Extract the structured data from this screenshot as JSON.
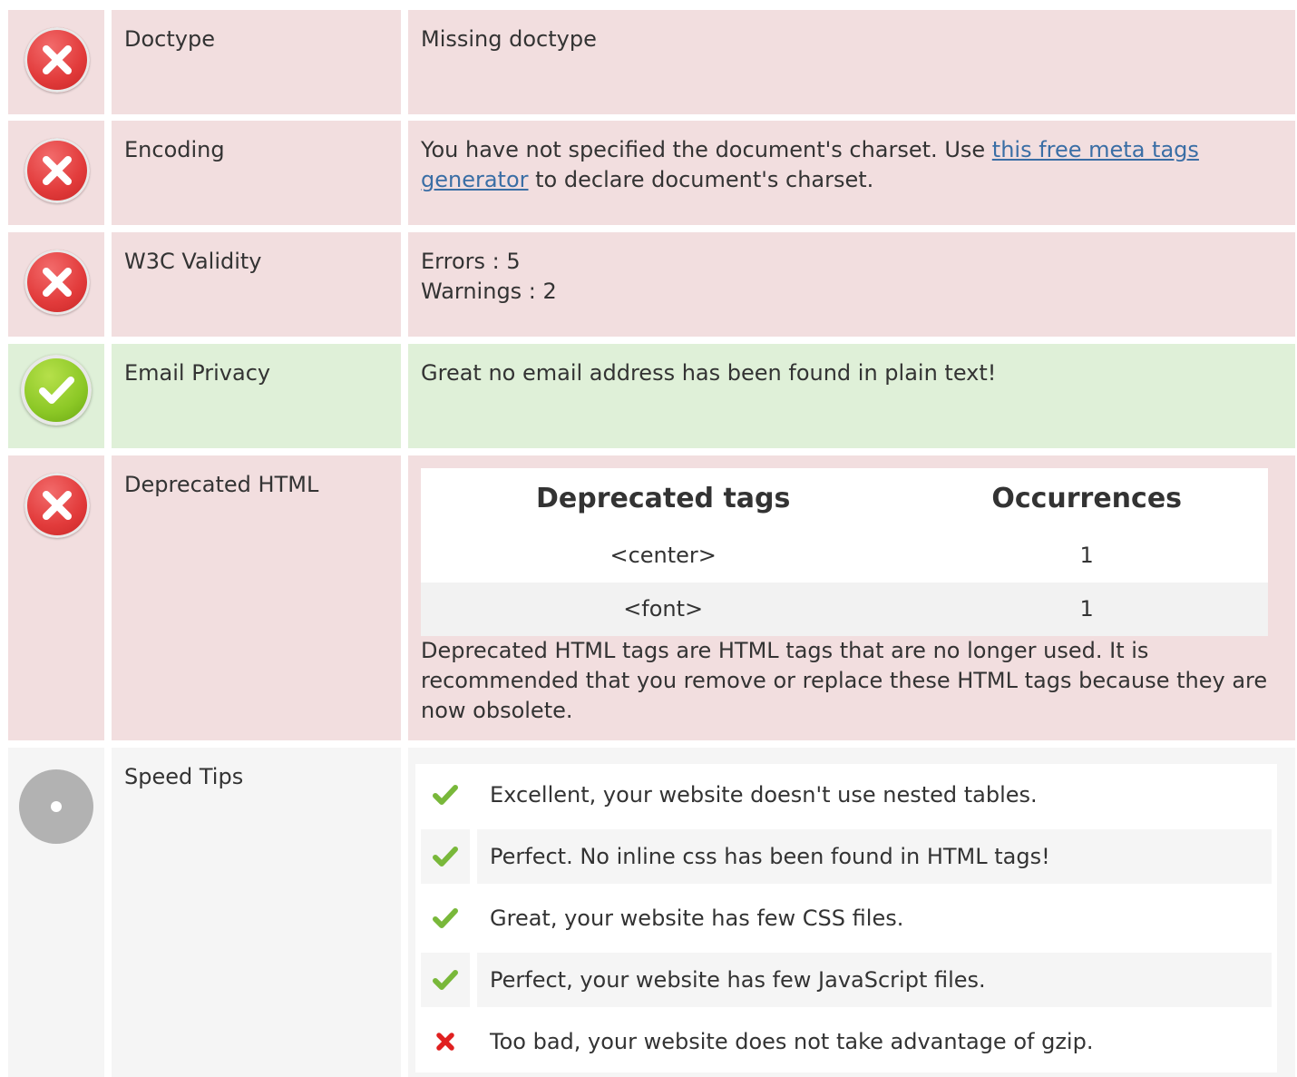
{
  "rows": {
    "doctype": {
      "label": "Doctype",
      "status": "error",
      "value": "Missing doctype"
    },
    "encoding": {
      "label": "Encoding",
      "status": "error",
      "text_before": "You have not specified the document's charset. Use ",
      "link_text": "this free meta tags generator",
      "text_after": " to declare document's charset."
    },
    "w3c": {
      "label": "W3C Validity",
      "status": "error",
      "errors": "Errors : 5",
      "warnings": "Warnings : 2"
    },
    "email": {
      "label": "Email Privacy",
      "status": "ok",
      "value": "Great no email address has been found in plain text!"
    },
    "deprecated": {
      "label": "Deprecated HTML",
      "status": "error",
      "headers": [
        "Deprecated tags",
        "Occurrences"
      ],
      "rows": [
        {
          "tag": "<center>",
          "count": "1"
        },
        {
          "tag": "<font>",
          "count": "1"
        }
      ],
      "note": "Deprecated HTML tags are HTML tags that are no longer used. It is recommended that you remove or replace these HTML tags because they are now obsolete."
    },
    "speed": {
      "label": "Speed Tips",
      "status": "neutral",
      "tips": [
        {
          "icon": "check-icon",
          "text": "Excellent, your website doesn't use nested tables."
        },
        {
          "icon": "check-icon",
          "text": "Perfect. No inline css has been found in HTML tags!"
        },
        {
          "icon": "check-icon",
          "text": "Great, your website has few CSS files."
        },
        {
          "icon": "check-icon",
          "text": "Perfect, your website has few JavaScript files."
        },
        {
          "icon": "cross-icon",
          "text": "Too bad, your website does not take advantage of gzip."
        }
      ]
    }
  },
  "colors": {
    "error_bg": "#f2dedf",
    "ok_bg": "#dff0d8",
    "neutral_bg": "#f5f5f5",
    "check": "#79b83a",
    "cross": "#e02020",
    "link": "#3a6ea5"
  }
}
